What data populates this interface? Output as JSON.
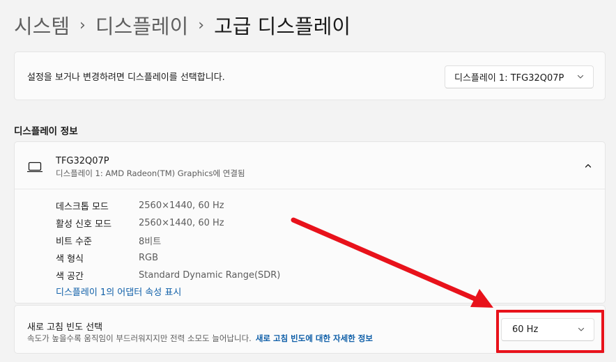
{
  "breadcrumb": {
    "items": [
      "시스템",
      "디스플레이"
    ],
    "current": "고급 디스플레이",
    "separator": "›"
  },
  "display_select": {
    "description": "설정을 보거나 변경하려면 디스플레이를 선택합니다.",
    "selected": "디스플레이 1: TFG32Q07P"
  },
  "display_info": {
    "section_title": "디스플레이 정보",
    "monitor_name": "TFG32Q07P",
    "monitor_connection": "디스플레이 1: AMD Radeon(TM) Graphics에 연결됨",
    "rows": [
      {
        "label": "데스크톱 모드",
        "value": "2560×1440, 60 Hz"
      },
      {
        "label": "활성 신호 모드",
        "value": "2560×1440, 60 Hz"
      },
      {
        "label": "비트 수준",
        "value": "8비트"
      },
      {
        "label": "색 형식",
        "value": "RGB"
      },
      {
        "label": "색 공간",
        "value": "Standard Dynamic Range(SDR)"
      }
    ],
    "adapter_link": "디스플레이 1의 어댑터 속성 표시"
  },
  "refresh_rate": {
    "title": "새로 고침 빈도 선택",
    "description": "속도가 높을수록 움직임이 부드러워지지만 전력 소모도 늘어납니다.",
    "link": "새로 고침 빈도에 대한 자세한 정보",
    "selected": "60 Hz"
  },
  "annotation": {
    "color": "#e8121b"
  },
  "icons": {
    "monitor": "monitor-icon",
    "collapse": "chevron-up-icon",
    "dropdown": "chevron-down-icon"
  }
}
